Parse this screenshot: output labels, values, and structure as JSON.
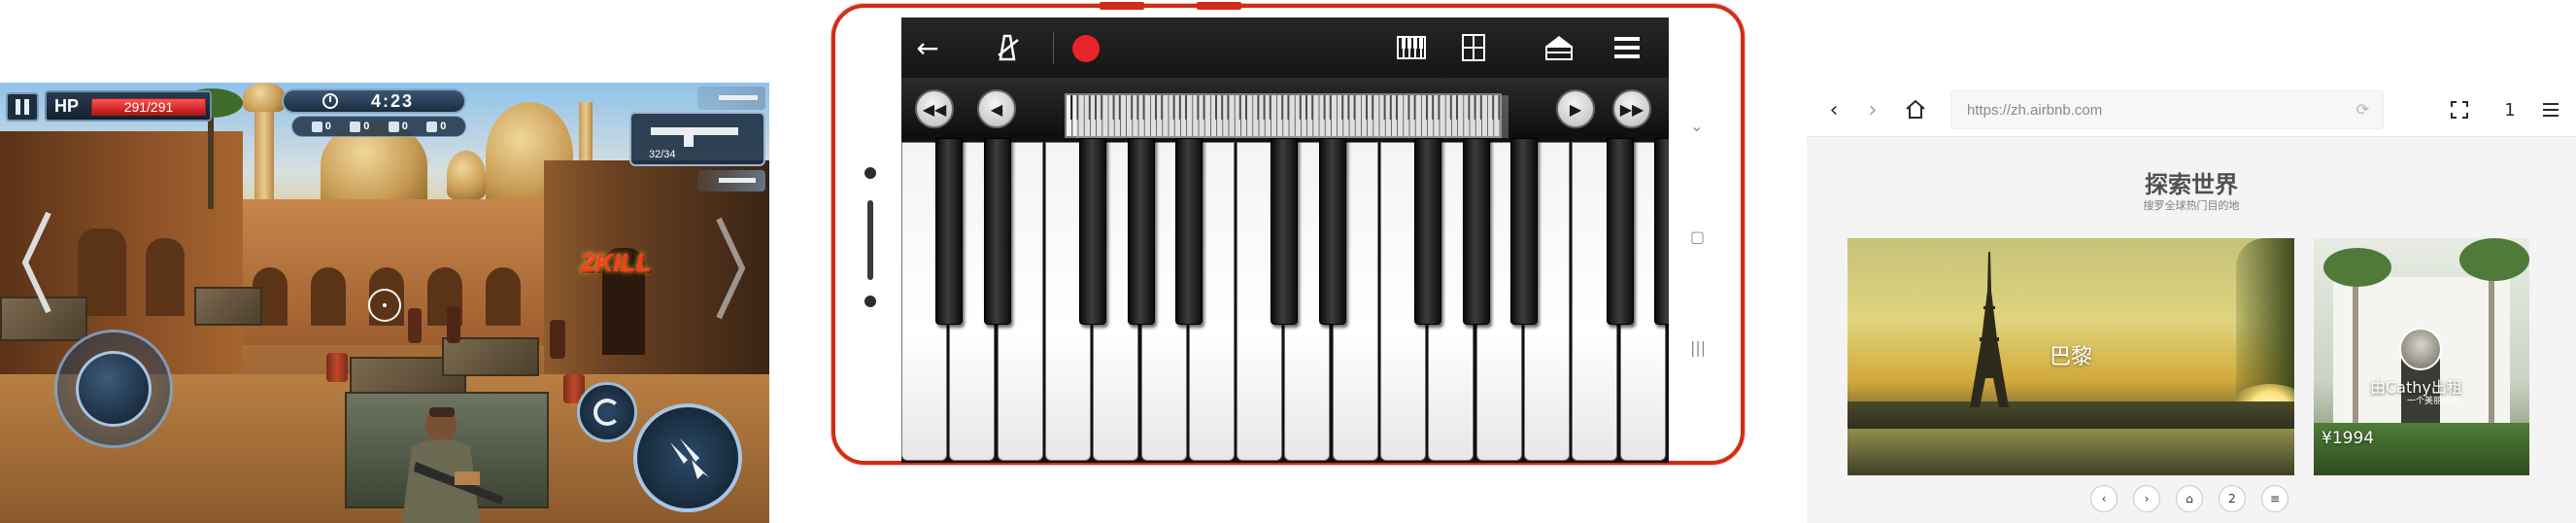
{
  "game": {
    "hp_label": "HP",
    "hp_value": "291/291",
    "hp_fraction": 1.0,
    "timer": "4:23",
    "stats": [
      {
        "icon": "gem-icon",
        "value": "0"
      },
      {
        "icon": "cross-swords-icon",
        "value": "0"
      },
      {
        "icon": "skull-icon",
        "value": "0"
      },
      {
        "icon": "medkit-icon",
        "value": "0"
      }
    ],
    "ammo": "32/34",
    "kill_text": "KILL",
    "kill_count": "2",
    "colors": {
      "hp": "#d41f1f",
      "hud_border": "#8aa9c8",
      "kill": "#ff3b1e"
    }
  },
  "piano": {
    "toolbar": {
      "back_icon": "arrow-left-icon",
      "metronome_icon": "metronome-icon",
      "record_icon": "record-icon",
      "keyboard_icon": "piano-keys-icon",
      "dual_icon": "dual-keyboard-icon",
      "instrument_icon": "grand-piano-icon",
      "menu_icon": "menu-icon"
    },
    "softkeys": [
      "⌄",
      "▢",
      "|||"
    ],
    "colors": {
      "frame": "#d22c17",
      "record": "#e8232a"
    }
  },
  "browser": {
    "url": "https://zh.airbnb.com",
    "tab_count": "1",
    "title": "探索世界",
    "subtitle": "搜罗全球热门目的地",
    "card_city": "巴黎",
    "host_text": "由Cathy出租",
    "host_sub": "一个美丽的家",
    "price": "¥1994",
    "bottom_tab_count": "2"
  }
}
